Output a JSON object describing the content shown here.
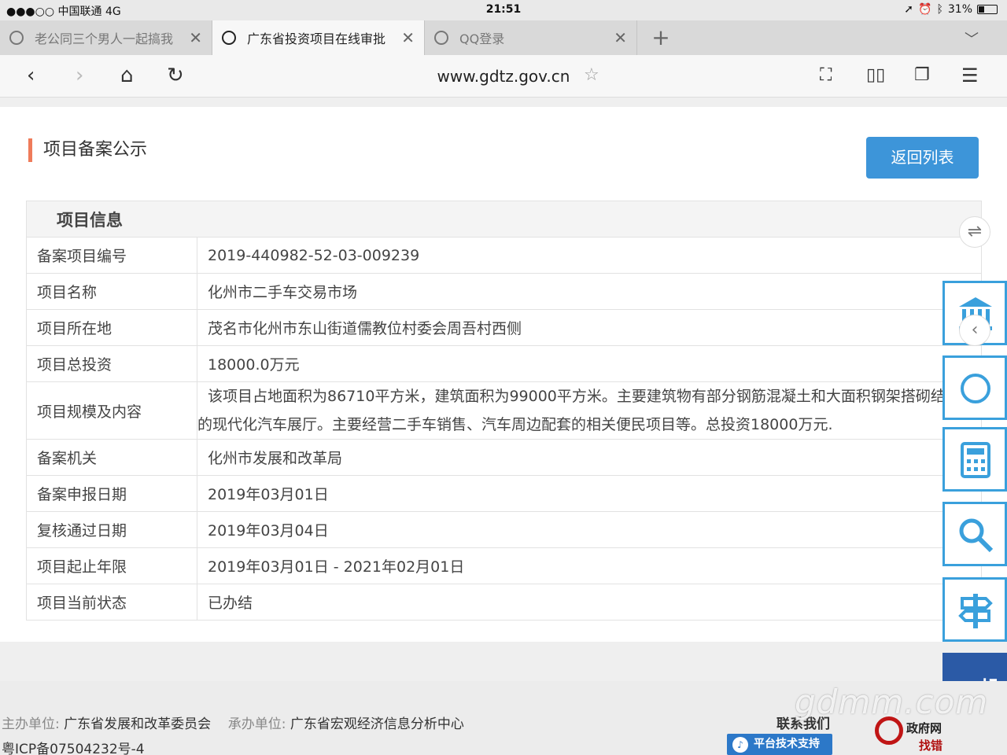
{
  "status": {
    "carrier": "●●●○○ 中国联通   4G",
    "time": "21:51",
    "battery": "31%",
    "battery_level": 0.31
  },
  "tabs": [
    {
      "title": "老公同三个男人一起搞我"
    },
    {
      "title": "广东省投资项目在线审批"
    },
    {
      "title": "QQ登录"
    }
  ],
  "nav": {
    "url": "www.gdtz.gov.cn"
  },
  "page": {
    "heading": "项目备案公示",
    "back_label": "返回列表",
    "section_title": "项目信息",
    "rows": [
      {
        "label": "备案项目编号",
        "value": "2019-440982-52-03-009239"
      },
      {
        "label": "项目名称",
        "value": "化州市二手车交易市场"
      },
      {
        "label": "项目所在地",
        "value": "茂名市化州市东山街道儒教位村委会周吾村西侧"
      },
      {
        "label": "项目总投资",
        "value": "18000.0万元"
      },
      {
        "label": "项目规模及内容",
        "value": "该项目占地面积为86710平方米，建筑面积为99000平方米。主要建筑物有部分钢筋混凝土和大面积钢架搭砌结构的现代化汽车展厅。主要经营二手车销售、汽车周边配套的相关便民项目等。总投资18000万元."
      },
      {
        "label": "备案机关",
        "value": "化州市发展和改革局"
      },
      {
        "label": "备案申报日期",
        "value": "2019年03月01日"
      },
      {
        "label": "复核通过日期",
        "value": "2019年03月04日"
      },
      {
        "label": "项目起止年限",
        "value": "2019年03月01日 - 2021年02月01日"
      },
      {
        "label": "项目当前状态",
        "value": "已办结"
      }
    ]
  },
  "footer": {
    "sponsor_key": "主办单位:",
    "sponsor_value": "广东省发展和改革委员会",
    "organizer_key": "承办单位:",
    "organizer_value": "广东省宏观经济信息分析中心",
    "icp": "粤ICP备07504232号-4",
    "contact": "联系我们",
    "support": "平台技术支持",
    "govweb_1": "政府网",
    "govweb_2": "找错",
    "banner_text": "投"
  },
  "watermark": "gdmm.com",
  "colors": {
    "accent": "#3d95d9",
    "heading_bar": "#ef7b5a",
    "side_border": "#3aa0dc"
  }
}
